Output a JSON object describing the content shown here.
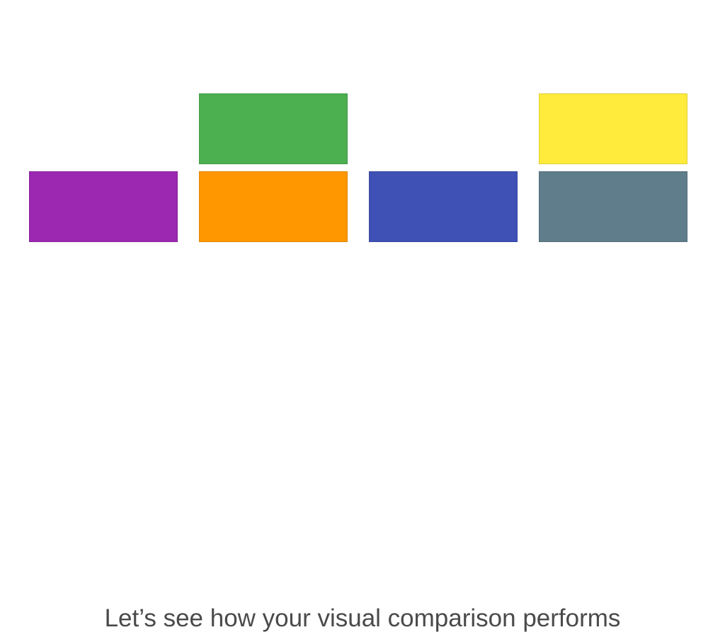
{
  "tiles": [
    {
      "id": "tile-green",
      "color": "#4caf50"
    },
    {
      "id": "tile-yellow",
      "color": "#ffeb3b"
    },
    {
      "id": "tile-purple",
      "color": "#9c27b0"
    },
    {
      "id": "tile-orange",
      "color": "#ff9800"
    },
    {
      "id": "tile-blue",
      "color": "#3f51b5"
    },
    {
      "id": "tile-slate",
      "color": "#607d8b"
    }
  ],
  "caption": {
    "text": "Let’s see how your visual comparison performs"
  }
}
